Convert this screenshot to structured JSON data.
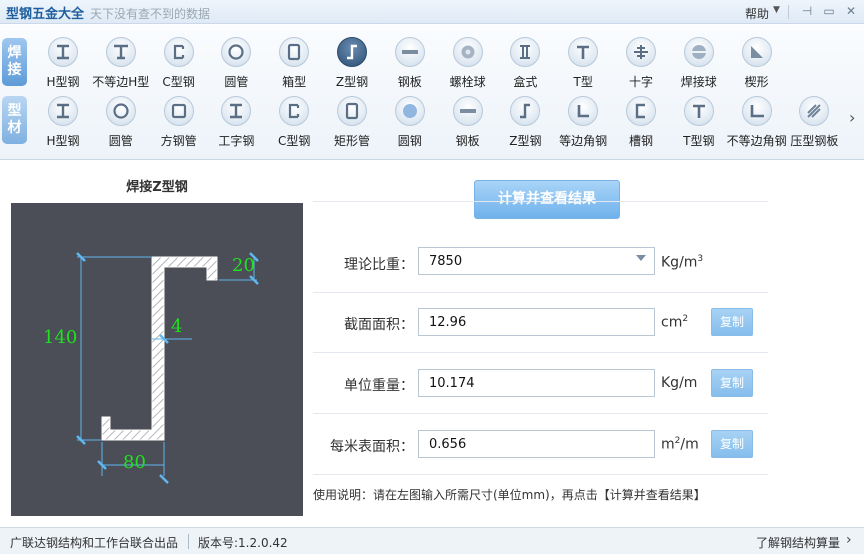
{
  "titlebar": {
    "app_name": "型钢五金大全",
    "slogan": "天下没有查不到的数据",
    "help_label": "帮助",
    "help_caret": "▼",
    "pin_glyph": "⊣",
    "minimize_glyph": "▭",
    "close_glyph": "✕"
  },
  "toolbar": {
    "weld_category": [
      "焊",
      "接"
    ],
    "section_category": [
      "型",
      "材"
    ],
    "weld_items": [
      {
        "label": "H型钢",
        "icon": "h-beam-icon"
      },
      {
        "label": "不等边H型",
        "icon": "unequal-h-beam-icon"
      },
      {
        "label": "C型钢",
        "icon": "c-channel-icon"
      },
      {
        "label": "圆管",
        "icon": "round-pipe-icon"
      },
      {
        "label": "箱型",
        "icon": "box-section-icon"
      },
      {
        "label": "Z型钢",
        "icon": "z-section-icon",
        "active": true
      },
      {
        "label": "钢板",
        "icon": "steel-plate-icon"
      },
      {
        "label": "螺栓球",
        "icon": "bolt-ball-icon"
      },
      {
        "label": "盒式",
        "icon": "box-type-icon"
      },
      {
        "label": "T型",
        "icon": "t-section-icon"
      },
      {
        "label": "十字",
        "icon": "cross-section-icon"
      },
      {
        "label": "焊接球",
        "icon": "welded-ball-icon"
      },
      {
        "label": "楔形",
        "icon": "wedge-icon"
      }
    ],
    "section_items": [
      {
        "label": "H型钢",
        "icon": "h-beam-icon"
      },
      {
        "label": "圆管",
        "icon": "round-pipe-icon"
      },
      {
        "label": "方钢管",
        "icon": "square-tube-icon"
      },
      {
        "label": "工字钢",
        "icon": "i-beam-icon"
      },
      {
        "label": "C型钢",
        "icon": "c-channel-icon"
      },
      {
        "label": "矩形管",
        "icon": "rect-tube-icon"
      },
      {
        "label": "圆钢",
        "icon": "round-bar-icon"
      },
      {
        "label": "钢板",
        "icon": "steel-plate-icon"
      },
      {
        "label": "Z型钢",
        "icon": "z-section-icon"
      },
      {
        "label": "等边角钢",
        "icon": "equal-angle-icon"
      },
      {
        "label": "槽钢",
        "icon": "channel-icon"
      },
      {
        "label": "T型钢",
        "icon": "t-section-icon"
      },
      {
        "label": "不等边角钢",
        "icon": "unequal-angle-icon"
      },
      {
        "label": "压型钢板",
        "icon": "profiled-sheet-icon"
      }
    ],
    "more_glyph": "›"
  },
  "diagram": {
    "title": "焊接Z型钢",
    "dims": {
      "height": "140",
      "lip": "20",
      "thickness": "4",
      "flange": "80"
    }
  },
  "calc": {
    "button_label": "计算并查看结果",
    "rows": [
      {
        "label": "理论比重：",
        "value": "7850",
        "unit": "Kg/m",
        "unit_sup": "3",
        "unit_prefix": ""
      },
      {
        "label": "截面面积：",
        "value": "12.96",
        "unit": "cm",
        "unit_sup": "2",
        "unit_prefix": "",
        "copy": "复制"
      },
      {
        "label": "单位重量：",
        "value": "10.174",
        "unit": "Kg/m",
        "unit_sup": "",
        "unit_prefix": "",
        "copy": "复制"
      },
      {
        "label": "每米表面积：",
        "value": "0.656",
        "unit": "/m",
        "unit_sup": "2",
        "unit_prefix": "m",
        "copy": "复制"
      }
    ],
    "usage": "使用说明：请在左图输入所需尺寸(单位mm)，再点击【计算并查看结果】"
  },
  "statusbar": {
    "credit": "广联达钢结构和工作台联合出品",
    "version": "版本号:1.2.0.42",
    "learn_more": "了解钢结构算量",
    "arrow": "›"
  },
  "colors": {
    "accent": "#6fb2ec",
    "dimension_text": "#20e020",
    "diagram_bg": "#4b4e56"
  }
}
